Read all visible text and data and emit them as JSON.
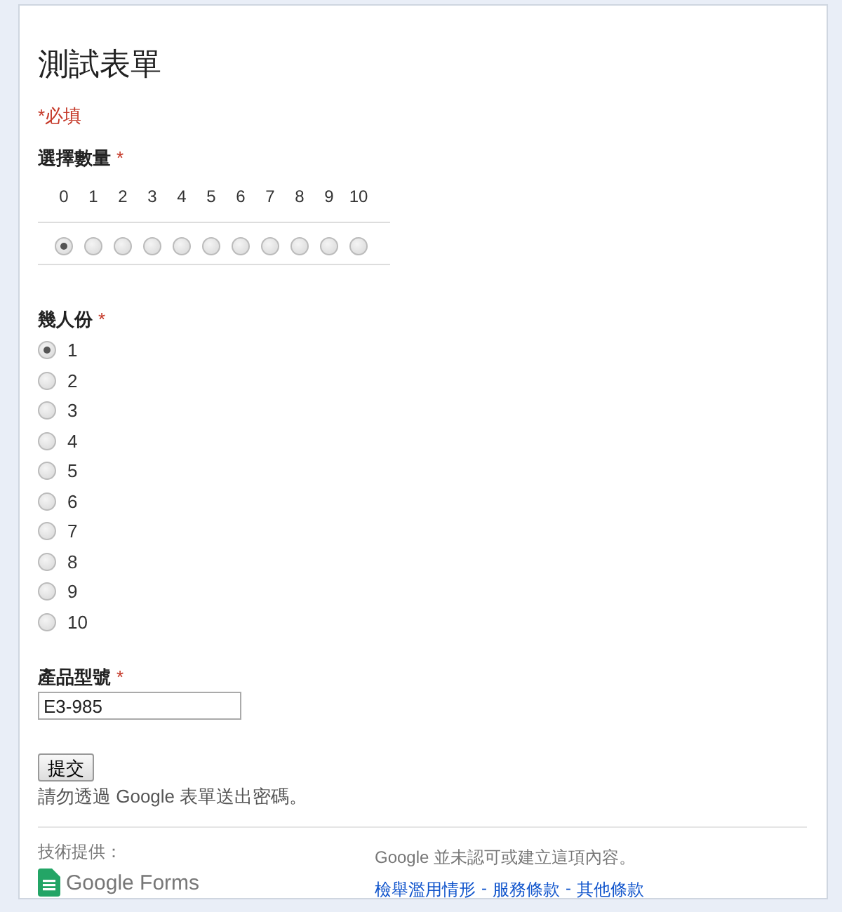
{
  "form": {
    "title": "測試表單",
    "required_note": "*必填"
  },
  "questions": [
    {
      "kind": "scale",
      "label": "選擇數量",
      "required": true,
      "required_mark": "*",
      "options": [
        {
          "label": "0",
          "selected": true
        },
        {
          "label": "1",
          "selected": false
        },
        {
          "label": "2",
          "selected": false
        },
        {
          "label": "3",
          "selected": false
        },
        {
          "label": "4",
          "selected": false
        },
        {
          "label": "5",
          "selected": false
        },
        {
          "label": "6",
          "selected": false
        },
        {
          "label": "7",
          "selected": false
        },
        {
          "label": "8",
          "selected": false
        },
        {
          "label": "9",
          "selected": false
        },
        {
          "label": "10",
          "selected": false
        }
      ]
    },
    {
      "kind": "radio",
      "label": "幾人份",
      "required": true,
      "required_mark": "*",
      "options": [
        {
          "label": "1",
          "selected": true
        },
        {
          "label": "2",
          "selected": false
        },
        {
          "label": "3",
          "selected": false
        },
        {
          "label": "4",
          "selected": false
        },
        {
          "label": "5",
          "selected": false
        },
        {
          "label": "6",
          "selected": false
        },
        {
          "label": "7",
          "selected": false
        },
        {
          "label": "8",
          "selected": false
        },
        {
          "label": "9",
          "selected": false
        },
        {
          "label": "10",
          "selected": false
        }
      ]
    },
    {
      "kind": "text",
      "label": "產品型號",
      "required": true,
      "required_mark": "*",
      "value": "E3-985"
    }
  ],
  "submit": {
    "label": "提交",
    "note": "請勿透過 Google 表單送出密碼。"
  },
  "footer": {
    "powered_by": "技術提供：",
    "brand": "Google Forms",
    "disclaimer": "Google 並未認可或建立這項內容。",
    "links": [
      "檢舉濫用情形",
      "服務條款",
      "其他條款"
    ],
    "separators": [
      "-",
      "-"
    ]
  }
}
